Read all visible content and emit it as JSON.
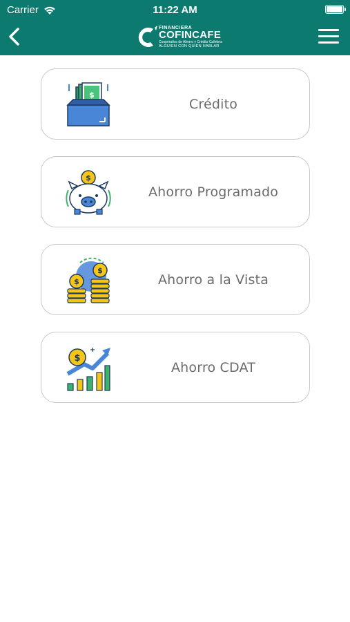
{
  "status_bar": {
    "carrier": "Carrier",
    "time": "11:22 AM",
    "icons": [
      "wifi-icon",
      "battery-icon"
    ]
  },
  "header": {
    "background_color": "#0d7a6f",
    "logo": {
      "top": "FINANCIERA",
      "name": "COFINCAFE",
      "sub": "Cooperativa de Ahorro y Crédito Cafetera",
      "tagline": "ALGUIEN CON QUIEN HABLAR"
    },
    "icons": [
      "back-icon",
      "menu-icon"
    ]
  },
  "menu": {
    "items": [
      {
        "label": "Crédito",
        "icon": "money-box-icon"
      },
      {
        "label": "Ahorro Programado",
        "icon": "piggy-bank-icon"
      },
      {
        "label": "Ahorro a la Vista",
        "icon": "coin-stacks-icon"
      },
      {
        "label": "Ahorro CDAT",
        "icon": "growth-chart-icon"
      }
    ],
    "border_color": "#c8c8c8",
    "label_color": "#6b6b6b"
  }
}
